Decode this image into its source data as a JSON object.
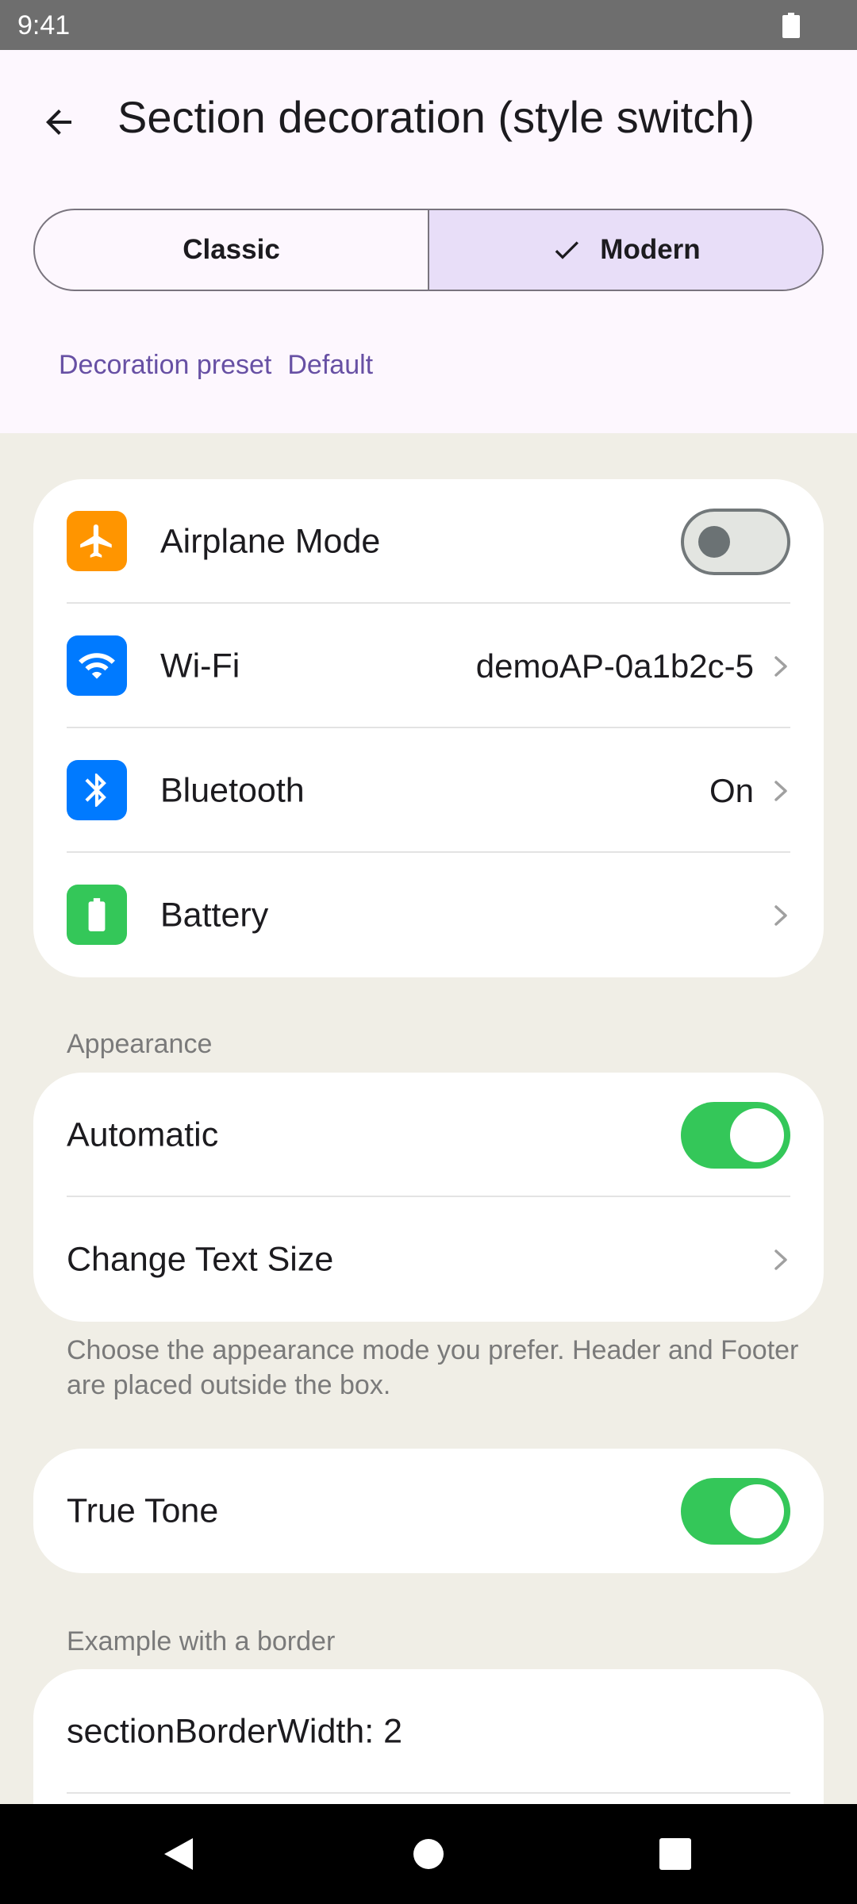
{
  "status_bar": {
    "time": "9:41",
    "battery_icon": "battery-full-icon"
  },
  "header": {
    "back_icon": "arrow-back-icon",
    "title": "Section decoration (style switch)"
  },
  "style_switch": {
    "options": [
      "Classic",
      "Modern"
    ],
    "selected": "Modern",
    "check_icon": "check-icon"
  },
  "preset": {
    "label": "Decoration preset",
    "value": "Default"
  },
  "connectivity": {
    "items": [
      {
        "label": "Airplane Mode",
        "icon": "airplane-icon",
        "icon_color": "#ff9500",
        "toggle": false
      },
      {
        "label": "Wi-Fi",
        "icon": "wifi-icon",
        "icon_color": "#007aff",
        "value": "demoAP-0a1b2c-5"
      },
      {
        "label": "Bluetooth",
        "icon": "bluetooth-icon",
        "icon_color": "#007aff",
        "value": "On"
      },
      {
        "label": "Battery",
        "icon": "battery-icon",
        "icon_color": "#34c759",
        "value": ""
      }
    ]
  },
  "appearance": {
    "header": "Appearance",
    "items": [
      {
        "label": "Automatic",
        "toggle": true
      },
      {
        "label": "Change Text Size"
      }
    ],
    "footer": "Choose the appearance mode you prefer. Header and Footer are placed outside the box."
  },
  "true_tone": {
    "label": "True Tone",
    "toggle": true
  },
  "border_example": {
    "header": "Example with a border",
    "items": [
      {
        "label": "sectionBorderWidth: 2"
      }
    ]
  },
  "colors": {
    "toggle_on": "#34c759",
    "accent": "#6750a4",
    "selected_segment": "#e8def8"
  },
  "nav_bar": {
    "icons": [
      "nav-back-icon",
      "nav-home-icon",
      "nav-recents-icon"
    ]
  }
}
